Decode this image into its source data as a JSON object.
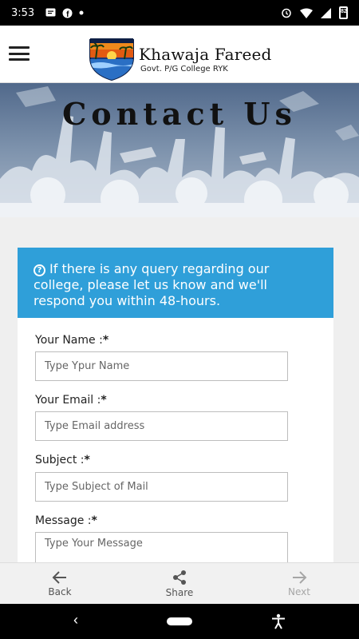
{
  "status_bar": {
    "time": "3:53",
    "battery": "82",
    "notification_icons": [
      "message-icon",
      "facebook-icon",
      "dot-icon"
    ],
    "system_icons": [
      "alarm-icon",
      "wifi-icon",
      "signal-icon",
      "battery-icon"
    ]
  },
  "header": {
    "title": "Khawaja Fareed",
    "subtitle": "Govt. P/G College RYK",
    "menu_icon": "hamburger-menu-icon",
    "logo_icon": "college-crest-logo"
  },
  "banner": {
    "title": "Contact Us"
  },
  "notice": {
    "icon": "question-circle-icon",
    "text": "If there is any query regarding our college, please let us know and we'll respond you within 48-hours."
  },
  "form": {
    "name": {
      "label": "Your Name :",
      "required_mark": "*",
      "placeholder": "Type Ypur Name",
      "value": ""
    },
    "email": {
      "label": "Your Email :",
      "required_mark": "*",
      "placeholder": "Type Email address",
      "value": ""
    },
    "subject": {
      "label": "Subject :",
      "required_mark": "*",
      "placeholder": "Type Subject of Mail",
      "value": ""
    },
    "message": {
      "label": "Message :",
      "required_mark": "*",
      "placeholder": "Type Your Message",
      "value": ""
    }
  },
  "bottom_bar": {
    "back_label": "Back",
    "share_label": "Share",
    "next_label": "Next"
  },
  "nav_bar": {
    "back_glyph": "‹"
  },
  "colors": {
    "notice_bg": "#2f9fd9",
    "status_bar_bg": "#000000",
    "bottom_bar_bg": "#f1f1f1"
  }
}
